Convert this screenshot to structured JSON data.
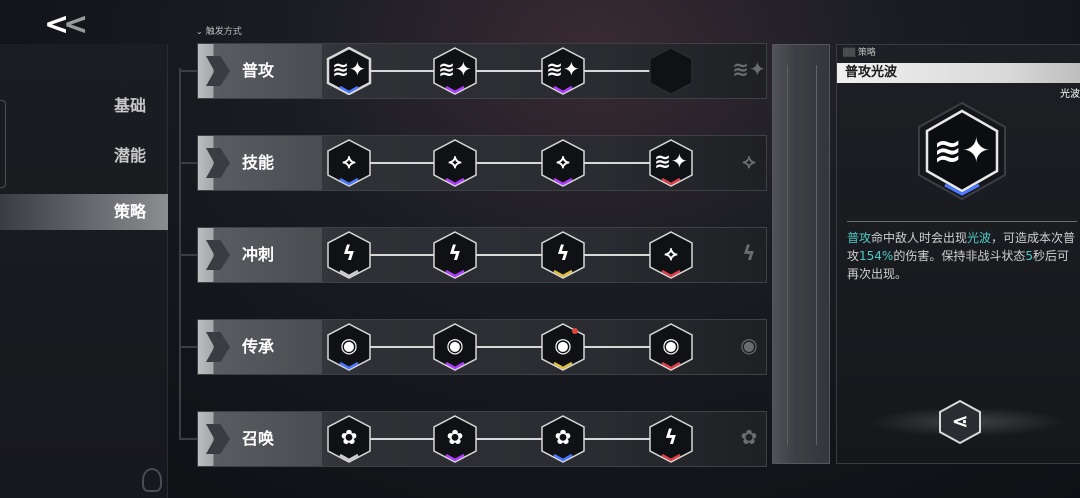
{
  "nav": {
    "back_label": "<<",
    "items": [
      {
        "label": "基础",
        "active": false
      },
      {
        "label": "潜能",
        "active": false
      },
      {
        "label": "策略",
        "active": true
      }
    ]
  },
  "header": {
    "trigger_label": "触发方式"
  },
  "rows": [
    {
      "label": "普攻",
      "nodes": [
        "attack-slash-icon",
        "attack-slash-icon",
        "attack-slash-icon",
        "locked-node-icon",
        "attack-slash-icon"
      ],
      "node_accent": [
        "#4a78ff",
        "#b03cff",
        "#b03cff",
        "",
        ""
      ]
    },
    {
      "label": "技能",
      "nodes": [
        "spear-burst-icon",
        "spear-burst-icon",
        "spear-burst-icon",
        "attack-slash-icon",
        "spear-burst-icon"
      ],
      "node_accent": [
        "#4a78ff",
        "#b03cff",
        "#b03cff",
        "#e0404a",
        ""
      ]
    },
    {
      "label": "冲刺",
      "nodes": [
        "dash-bolt-icon",
        "dash-bolt-icon",
        "dash-bolt-icon",
        "spear-burst-icon",
        "dash-bolt-icon"
      ],
      "node_accent": [
        "#cccccc",
        "#b03cff",
        "#e0c040",
        "#e0404a",
        ""
      ]
    },
    {
      "label": "传承",
      "nodes": [
        "vortex-icon",
        "vortex-icon",
        "vortex-icon",
        "vortex-icon",
        "vortex-icon"
      ],
      "node_accent": [
        "#4a78ff",
        "#b03cff",
        "#e0c040",
        "#e0404a",
        ""
      ]
    },
    {
      "label": "召唤",
      "nodes": [
        "flower-summon-icon",
        "flower-summon-icon",
        "flower-summon-icon",
        "dash-bolt-icon",
        "flower-summon-icon"
      ],
      "node_accent": [
        "#cccccc",
        "#b03cff",
        "#4a78ff",
        "#e0404a",
        ""
      ]
    }
  ],
  "detail": {
    "tag": "策略",
    "title": "普攻光波",
    "corner_text": "光波",
    "icon": "attack-slash-icon",
    "desc_parts": [
      {
        "text": "普攻",
        "hl": true
      },
      {
        "text": "命中敌人时会出现",
        "hl": false
      },
      {
        "text": "光波",
        "hl": true
      },
      {
        "text": "，可造成本次普攻",
        "hl": false
      },
      {
        "text": "154%",
        "hl": true
      },
      {
        "text": "的伤害。保持非战斗状态",
        "hl": false
      },
      {
        "text": "5",
        "hl": true
      },
      {
        "text": "秒后可再次出现。",
        "hl": false
      }
    ],
    "share_icon": "share-icon"
  },
  "colors": {
    "highlight": "#4ec9c6",
    "active_nav": "#8b8d91"
  }
}
